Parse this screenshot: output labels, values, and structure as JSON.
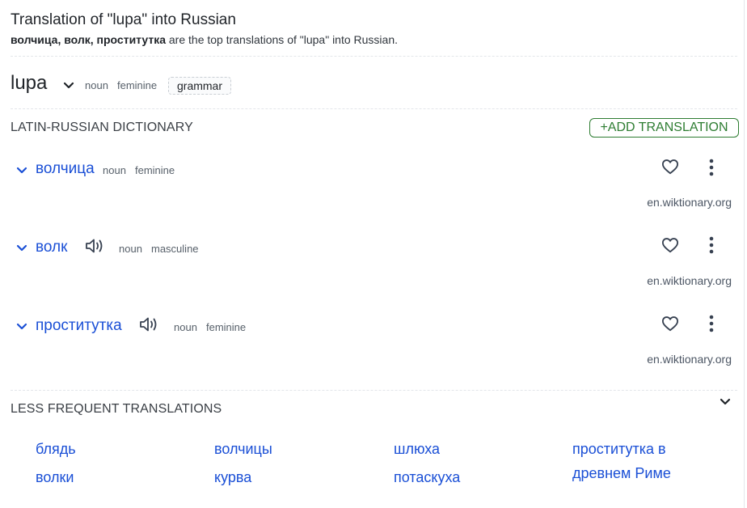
{
  "header": {
    "title": "Translation of \"lupa\" into Russian",
    "summary_bold": "волчица, волк, проститутка",
    "summary_rest": " are the top translations of \"lupa\" into Russian."
  },
  "headword": {
    "word": "lupa",
    "pos": "noun",
    "gender": "feminine",
    "grammar_label": "grammar"
  },
  "dictionary": {
    "title": "LATIN-RUSSIAN DICTIONARY",
    "add_label": "+ADD TRANSLATION",
    "entries": [
      {
        "word": "волчица",
        "pos": "noun",
        "gender": "feminine",
        "source": "en.wiktionary.org",
        "has_audio": false
      },
      {
        "word": "волк",
        "pos": "noun",
        "gender": "masculine",
        "source": "en.wiktionary.org",
        "has_audio": true
      },
      {
        "word": "проститутка",
        "pos": "noun",
        "gender": "feminine",
        "source": "en.wiktionary.org",
        "has_audio": true
      }
    ]
  },
  "less_frequent": {
    "title": "LESS FREQUENT TRANSLATIONS",
    "items": [
      "блядь",
      "волки",
      "волчицы",
      "курва",
      "шлюха",
      "потаскуха",
      "проститутка в",
      "древнем Риме"
    ]
  },
  "icons": {
    "chevron": "chevron-down-icon",
    "audio": "speaker-icon",
    "favorite": "heart-icon",
    "more": "more-vertical-icon"
  },
  "colors": {
    "link": "#1a4fd6",
    "accent_green": "#2e7d32",
    "muted": "#57606a"
  }
}
